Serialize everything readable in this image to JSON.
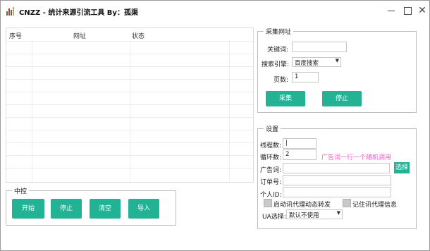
{
  "window": {
    "title": "CNZZ - 统计来源引流工具 By：孤渠",
    "controls": {
      "minimize": "—",
      "maximize": "☐",
      "close": "✕"
    }
  },
  "table": {
    "columns": [
      "序号",
      "网址",
      "状态"
    ]
  },
  "collect": {
    "title": "采集网址",
    "keyword_label": "关键词:",
    "keyword_value": "",
    "engine_label": "搜索引擎:",
    "engine_value": "百度搜索",
    "pages_label": "页数:",
    "pages_value": "1",
    "collect_button": "采集",
    "stop_button": "停止"
  },
  "settings": {
    "title": "设置",
    "threads_label": "线程数:",
    "threads_value": "|",
    "loops_label": "循环数:",
    "loops_value": "2",
    "ad_hint": "广告词一行一个随机调用",
    "ad_label": "广告词:",
    "ad_value": "",
    "select_button": "选择",
    "order_label": "订单号:",
    "order_value": "",
    "personal_label": "个人ID:",
    "personal_value": "",
    "proxy_forward_label": "启动讯代理动态转发",
    "remember_proxy_label": "记住讯代理信息",
    "ua_label": "UA选择:",
    "ua_value": "默认不使用"
  },
  "center": {
    "title": "中控",
    "start_button": "开始",
    "stop_button": "停止",
    "clear_button": "清空",
    "import_button": "导入"
  },
  "colors": {
    "accent": "#21b394",
    "hint": "#f25ac6"
  }
}
